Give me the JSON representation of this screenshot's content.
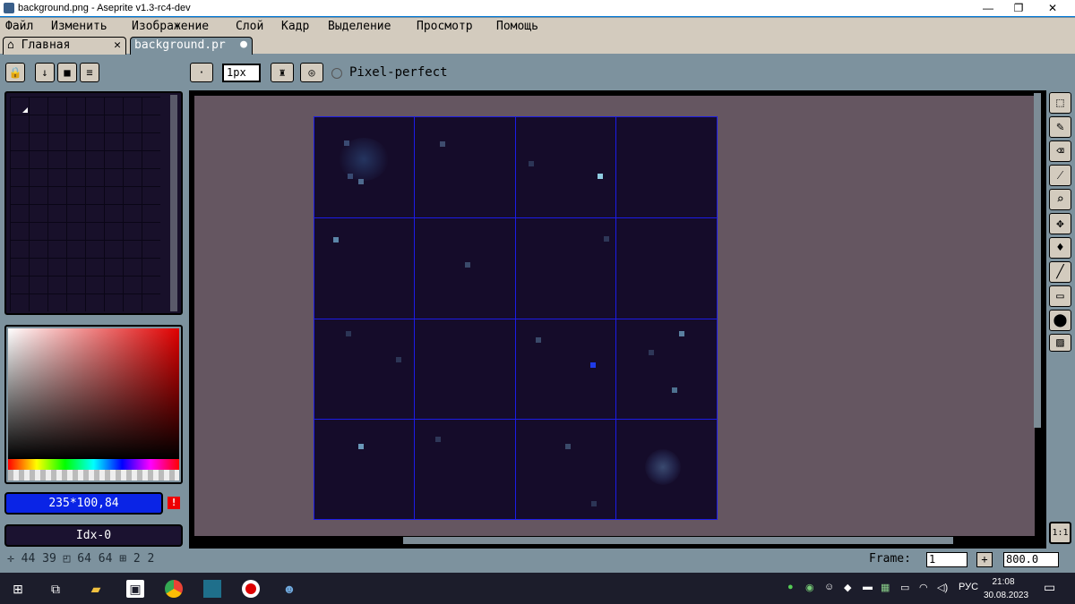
{
  "window": {
    "title": "background.png - Aseprite v1.3-rc4-dev"
  },
  "menu": [
    "Файл",
    "Изменить",
    "Изображение",
    "Слой",
    "Кадр",
    "Выделение",
    "Просмотр",
    "Помощь"
  ],
  "tabs": {
    "home": "Главная",
    "file": "background.pr"
  },
  "toolbar": {
    "brush_size": "1px",
    "pixel_perfect": "Pixel-perfect"
  },
  "color": {
    "value": "235*100,84",
    "index": "Idx-0",
    "hex_fg": "#0a24e6"
  },
  "status": {
    "position": "44 39",
    "size": "64 64",
    "grid": "2 2"
  },
  "frame": {
    "label": "Frame:",
    "value": "1",
    "zoom": "800.0"
  },
  "tools_right": {
    "zoom_reset": "1:1"
  },
  "tray": {
    "lang": "РУС",
    "time": "21:08",
    "date": "30.08.2023"
  }
}
